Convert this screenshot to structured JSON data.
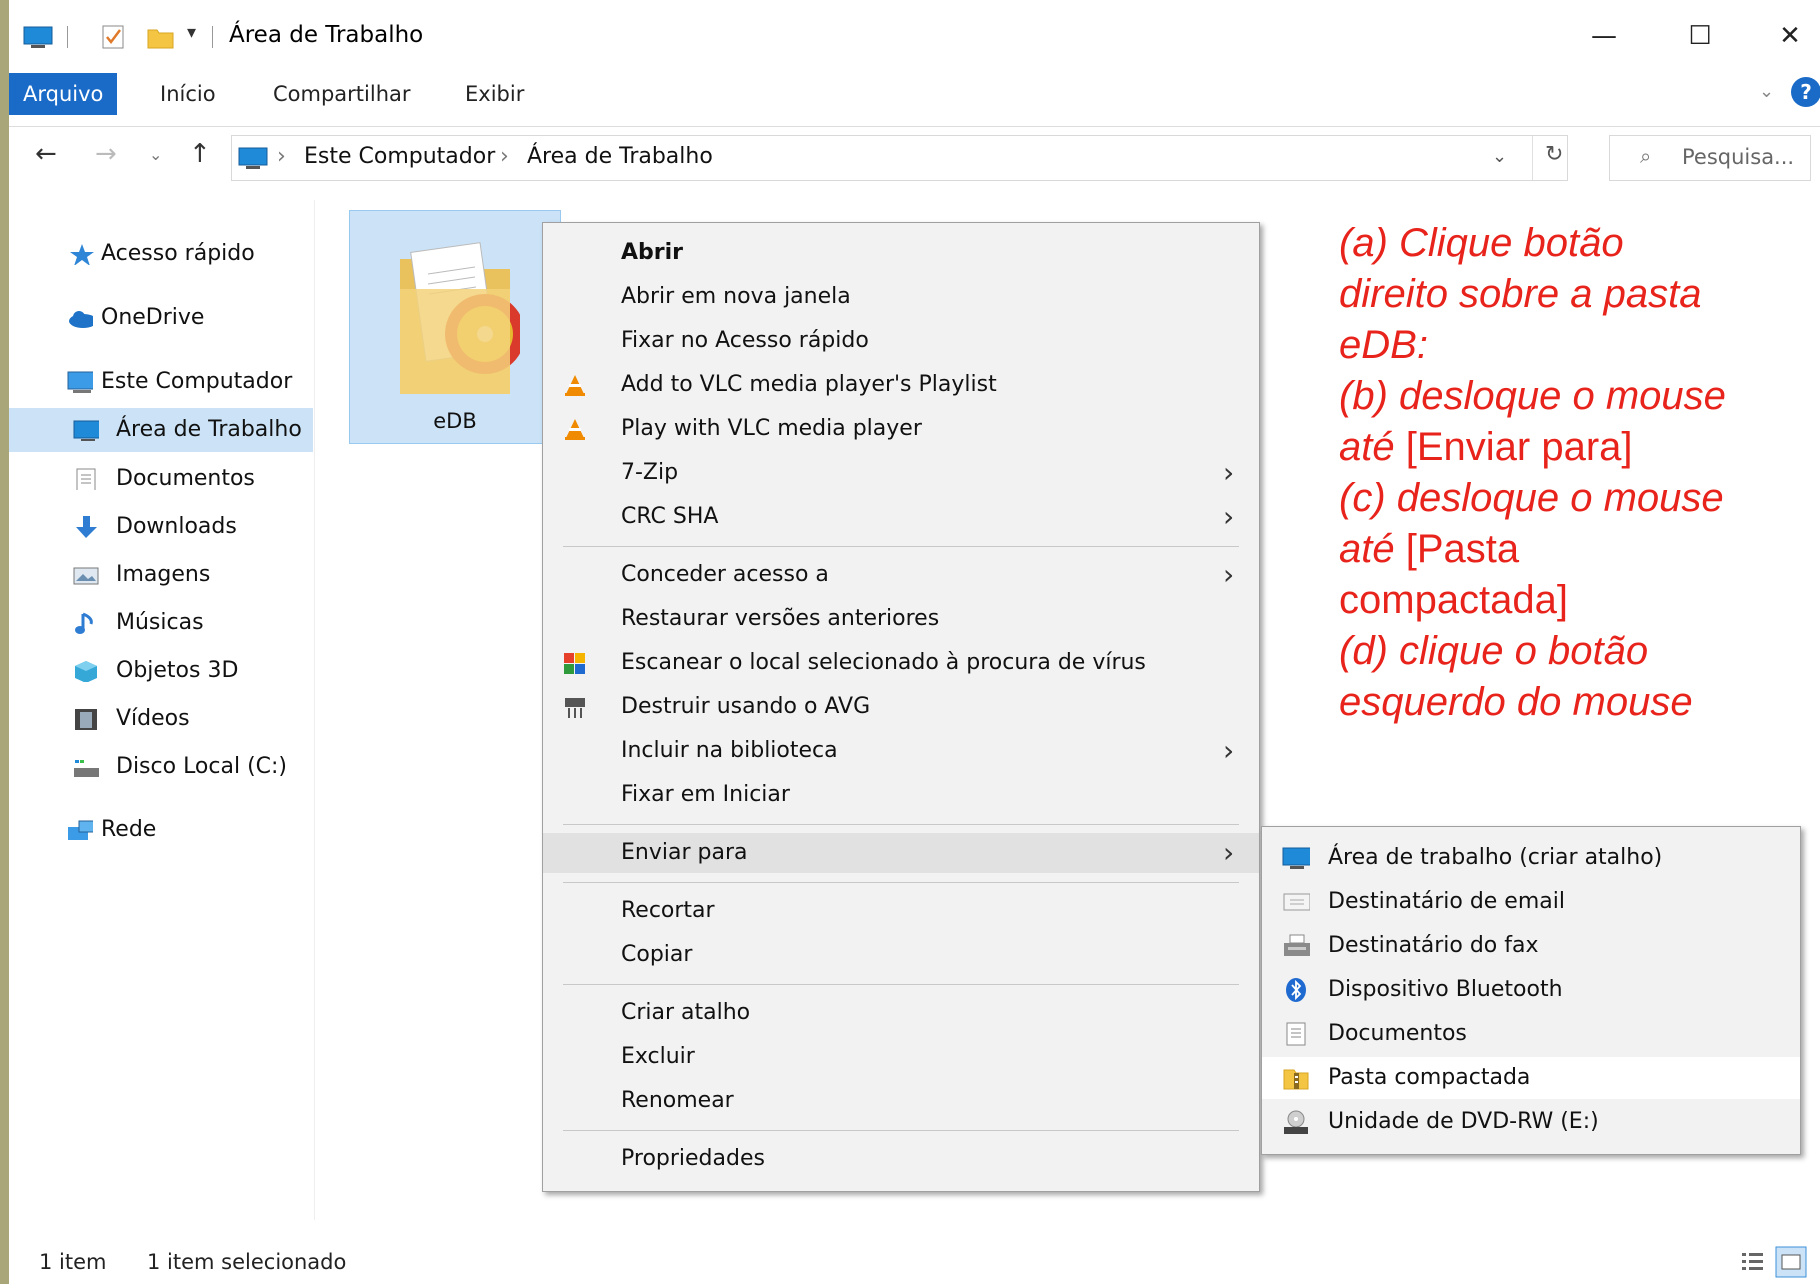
{
  "window": {
    "title": "Área de Trabalho",
    "controls": {
      "minimize": "—",
      "maximize": "☐",
      "close": "✕"
    }
  },
  "ribbon": {
    "tabs": [
      {
        "label": "Arquivo",
        "active": true
      },
      {
        "label": "Início"
      },
      {
        "label": "Compartilhar"
      },
      {
        "label": "Exibir"
      }
    ]
  },
  "address": {
    "breadcrumb": [
      "Este Computador",
      "Área de Trabalho"
    ],
    "separator": "›",
    "search_placeholder": "Pesquisa..."
  },
  "sidebar": {
    "items": [
      {
        "label": "Acesso rápido",
        "icon": "star-icon"
      },
      {
        "label": "OneDrive",
        "icon": "cloud-icon"
      },
      {
        "label": "Este Computador",
        "icon": "computer-icon"
      },
      {
        "label": "Área de Trabalho",
        "icon": "desktop-icon",
        "selected": true
      },
      {
        "label": "Documentos",
        "icon": "documents-icon"
      },
      {
        "label": "Downloads",
        "icon": "download-icon"
      },
      {
        "label": "Imagens",
        "icon": "pictures-icon"
      },
      {
        "label": "Músicas",
        "icon": "music-icon"
      },
      {
        "label": "Objetos 3D",
        "icon": "objects-3d-icon"
      },
      {
        "label": "Vídeos",
        "icon": "videos-icon"
      },
      {
        "label": "Disco Local (C:)",
        "icon": "disk-icon"
      },
      {
        "label": "Rede",
        "icon": "network-icon"
      }
    ]
  },
  "content": {
    "folder": {
      "label": "eDB",
      "icon": "folder-icon"
    }
  },
  "context_menu": {
    "items": [
      {
        "label": "Abrir",
        "bold": true
      },
      {
        "label": "Abrir em nova janela"
      },
      {
        "label": "Fixar no Acesso rápido"
      },
      {
        "label": "Add to VLC media player's Playlist",
        "icon": "vlc-icon"
      },
      {
        "label": "Play with VLC media player",
        "icon": "vlc-icon"
      },
      {
        "label": "7-Zip",
        "submenu": true
      },
      {
        "label": "CRC SHA",
        "submenu": true
      },
      {
        "label": "Conceder acesso a",
        "submenu": true
      },
      {
        "label": "Restaurar versões anteriores"
      },
      {
        "label": "Escanear o local selecionado à procura de vírus",
        "icon": "avg-scan-icon"
      },
      {
        "label": "Destruir usando o AVG",
        "icon": "shredder-icon"
      },
      {
        "label": "Incluir na biblioteca",
        "submenu": true
      },
      {
        "label": "Fixar em Iniciar"
      },
      {
        "label": "Enviar para",
        "submenu": true,
        "hover": true
      },
      {
        "label": "Recortar"
      },
      {
        "label": "Copiar"
      },
      {
        "label": "Criar atalho"
      },
      {
        "label": "Excluir"
      },
      {
        "label": "Renomear"
      },
      {
        "label": "Propriedades"
      }
    ],
    "arrow": "›"
  },
  "send_to_menu": {
    "items": [
      {
        "label": "Área de trabalho (criar atalho)",
        "icon": "desktop-icon"
      },
      {
        "label": "Destinatário de email",
        "icon": "mail-icon"
      },
      {
        "label": "Destinatário do fax",
        "icon": "fax-icon"
      },
      {
        "label": "Dispositivo Bluetooth",
        "icon": "bluetooth-icon"
      },
      {
        "label": "Documentos",
        "icon": "documents-icon"
      },
      {
        "label": "Pasta compactada",
        "icon": "zip-folder-icon",
        "hover": true
      },
      {
        "label": "Unidade de DVD-RW (E:)",
        "icon": "dvd-drive-icon"
      }
    ]
  },
  "annotation": {
    "lines": [
      {
        "text": "(a) Clique botão",
        "italic": true
      },
      {
        "text": "direito sobre a pasta",
        "italic": true
      },
      {
        "text": "eDB:",
        "italic": true
      },
      {
        "text": "(b) desloque o mouse",
        "italic": true
      },
      {
        "parts": [
          {
            "text": "até",
            "italic": true
          },
          {
            "text": " [Enviar para]",
            "italic": false
          }
        ]
      },
      {
        "text": "(c) desloque o mouse",
        "italic": true
      },
      {
        "parts": [
          {
            "text": "até",
            "italic": true
          },
          {
            "text": " [Pasta",
            "italic": false
          }
        ]
      },
      {
        "text": "compactada]",
        "italic": false
      },
      {
        "text": "(d) clique o botão",
        "italic": true
      },
      {
        "text": "esquerdo do mouse",
        "italic": true
      }
    ],
    "color": "#e8231b"
  },
  "status": {
    "count": "1 item",
    "selected": "1 item selecionado"
  },
  "colors": {
    "accent": "#1a6bc8",
    "selection": "#cce3f7",
    "outer_background": "#a9a77a"
  }
}
